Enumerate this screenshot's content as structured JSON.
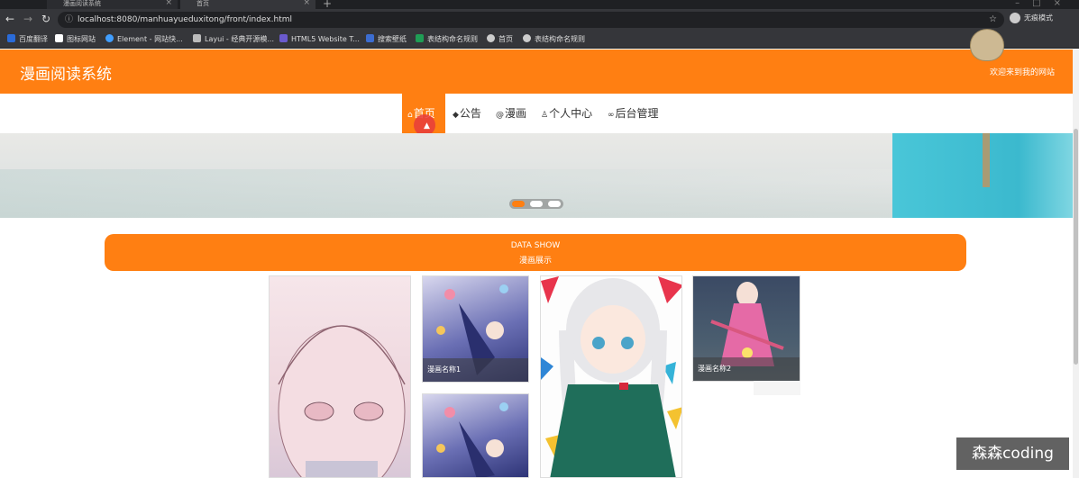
{
  "browser": {
    "tabs": [
      {
        "label": "漫画阅读系统"
      },
      {
        "label": "首页"
      }
    ],
    "url": "localhost:8080/manhuayueduxitong/front/index.html",
    "profile_label": "无痕模式",
    "bookmarks": [
      {
        "label": "百度翻译",
        "icon": "baidu-fanyi-icon",
        "color": "#2a6bd9"
      },
      {
        "label": "图标网站",
        "icon": "flag-icon",
        "color": "#ffffff"
      },
      {
        "label": "Element - 网站快...",
        "icon": "element-icon",
        "color": "#409eff"
      },
      {
        "label": "Layui - 经典开源模...",
        "icon": "layui-icon",
        "color": "#bbbbbb"
      },
      {
        "label": "HTML5 Website T...",
        "icon": "html5-icon",
        "color": "#6a5acd"
      },
      {
        "label": "搜索壁纸",
        "icon": "wallpaper-icon",
        "color": "#3c6dd1"
      },
      {
        "label": "表结构命名规则",
        "icon": "sheet-icon",
        "color": "#1f9d55"
      },
      {
        "label": "首页",
        "icon": "globe-icon",
        "color": "#cccccc"
      },
      {
        "label": "表结构命名规则",
        "icon": "globe-icon",
        "color": "#cccccc"
      }
    ]
  },
  "header": {
    "title": "漫画阅读系统",
    "welcome": "欢迎来到我的网站"
  },
  "nav": {
    "items": [
      {
        "label": "首页",
        "icon": "home-icon",
        "active": true
      },
      {
        "label": "公告",
        "icon": "graduation-cap-icon",
        "active": false
      },
      {
        "label": "漫画",
        "icon": "at-icon",
        "active": false
      },
      {
        "label": "个人中心",
        "icon": "user-icon",
        "active": false
      },
      {
        "label": "后台管理",
        "icon": "link-icon",
        "active": false
      }
    ]
  },
  "carousel": {
    "slides": 3,
    "active_slide": 1
  },
  "section": {
    "title_en": "DATA SHOW",
    "title_cn": "漫画展示"
  },
  "comics": [
    {
      "caption": ""
    },
    {
      "caption": "漫画名称1"
    },
    {
      "caption": ""
    },
    {
      "caption": ""
    },
    {
      "caption": "漫画名称2"
    }
  ],
  "watermark": "森森coding",
  "colors": {
    "accent": "#ff7f12"
  }
}
